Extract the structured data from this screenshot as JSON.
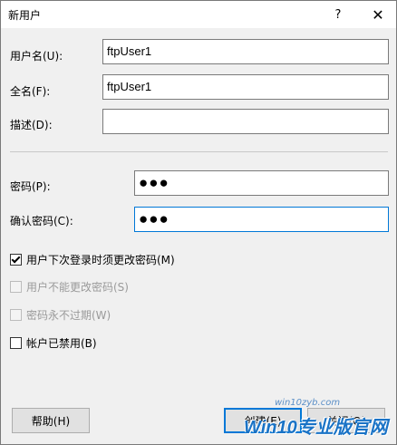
{
  "window": {
    "title": "新用户",
    "help_glyph": "?",
    "close_glyph": "✕"
  },
  "form": {
    "username_label": "用户名(U):",
    "username_value": "ftpUser1",
    "fullname_label": "全名(F):",
    "fullname_value": "ftpUser1",
    "description_label": "描述(D):",
    "description_value": "",
    "password_label": "密码(P):",
    "password_value": "●●●",
    "confirm_label": "确认密码(C):",
    "confirm_value": "●●●"
  },
  "options": [
    {
      "label": "用户下次登录时须更改密码(M)",
      "checked": true,
      "enabled": true
    },
    {
      "label": "用户不能更改密码(S)",
      "checked": false,
      "enabled": false
    },
    {
      "label": "密码永不过期(W)",
      "checked": false,
      "enabled": false
    },
    {
      "label": "帐户已禁用(B)",
      "checked": false,
      "enabled": true
    }
  ],
  "buttons": {
    "help": "帮助(H)",
    "create": "创建(E)",
    "close": "关闭(O)"
  },
  "watermark": {
    "brand": "Win10专业版官网",
    "url": "win10zyb.com"
  }
}
